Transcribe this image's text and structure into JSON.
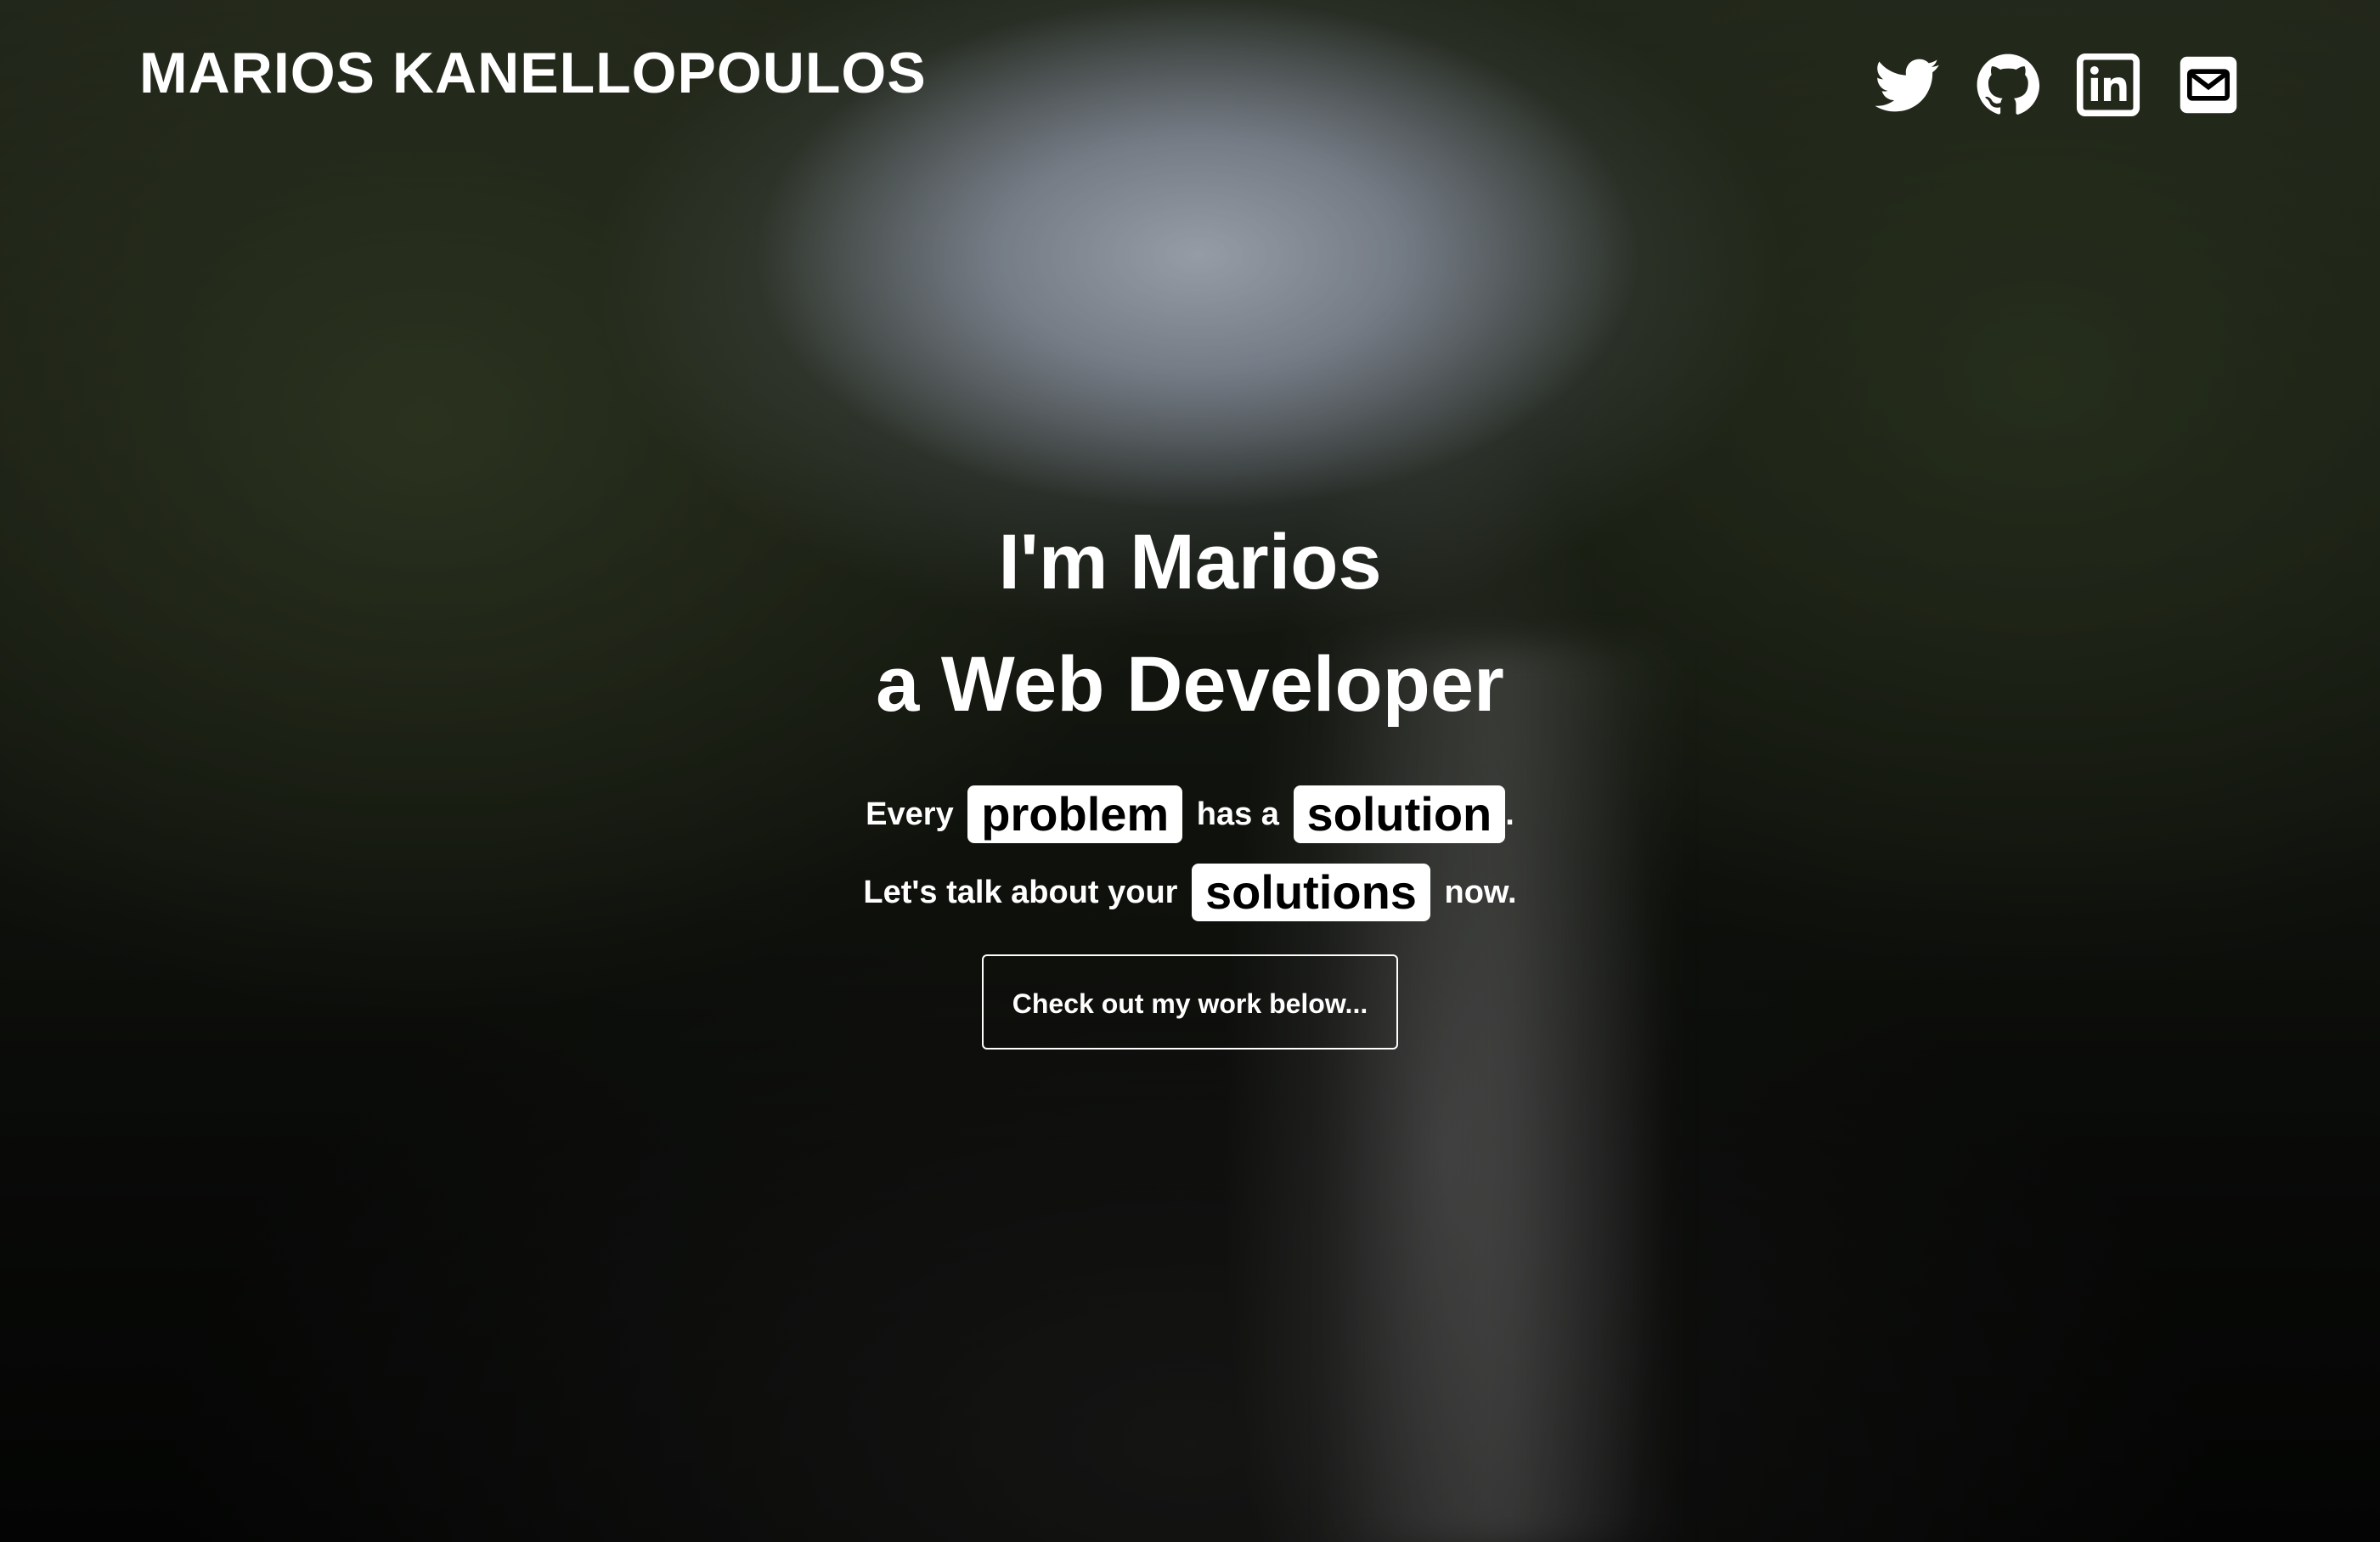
{
  "header": {
    "brand": "MARIOS KANELLOPOULOS",
    "social": [
      {
        "icon": "twitter-icon"
      },
      {
        "icon": "github-icon"
      },
      {
        "icon": "linkedin-icon"
      },
      {
        "icon": "email-icon"
      }
    ]
  },
  "hero": {
    "headline_line1": "I'm Marios",
    "headline_line2": "a Web Developer",
    "tagline1": {
      "before": "Every",
      "highlight1": "problem",
      "middle": "has a",
      "highlight2": "solution",
      "after": "."
    },
    "tagline2": {
      "before": "Let's talk about your",
      "highlight": "solutions",
      "after": "now."
    },
    "cta_label": "Check out my work below..."
  },
  "colors": {
    "text": "#ffffff",
    "highlight_bg": "#ffffff",
    "highlight_text": "#000000"
  }
}
